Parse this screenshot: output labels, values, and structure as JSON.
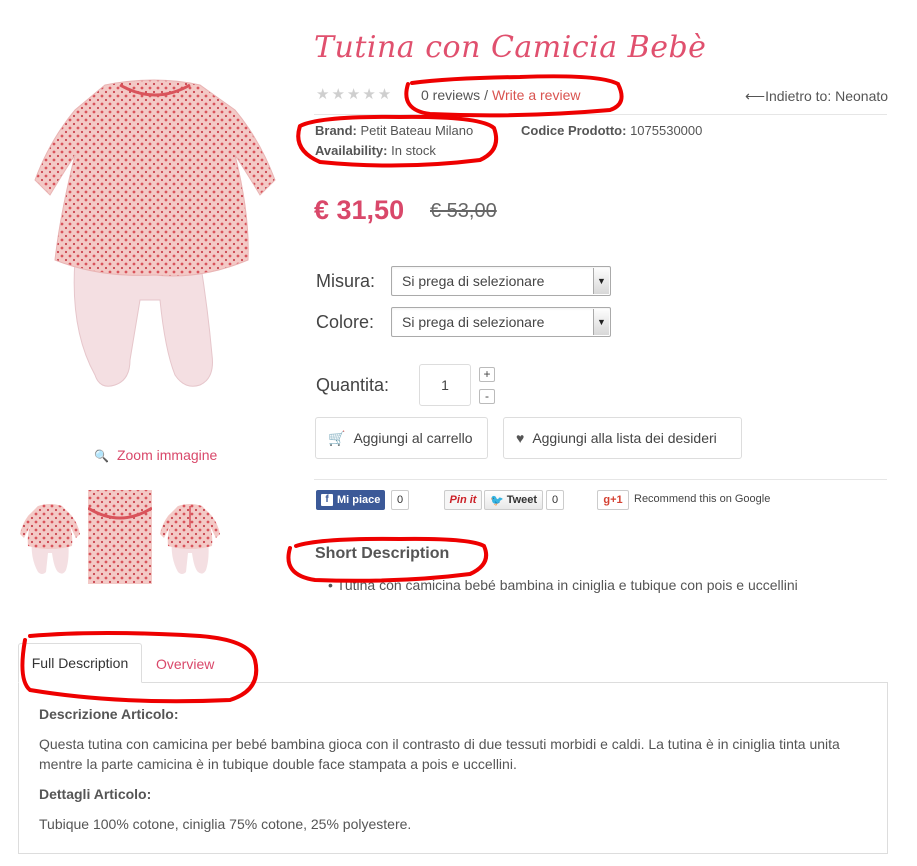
{
  "product": {
    "title": "Tutina con Camicia Bebè",
    "stars": "★★★★★",
    "reviews_count": "0 reviews",
    "reviews_sep": "/",
    "write_review": "Write a review",
    "back_link": "Indietro to: Neonato",
    "brand_label": "Brand:",
    "brand_value": "Petit Bateau Milano",
    "code_label": "Codice Prodotto:",
    "code_value": "1075530000",
    "availability_label": "Availability:",
    "availability_value": "In stock",
    "price": "€ 31,50",
    "old_price": "€ 53,00"
  },
  "options": {
    "size_label": "Misura:",
    "size_value": "Si prega di selezionare",
    "color_label": "Colore:",
    "color_value": "Si prega di selezionare",
    "qty_label": "Quantita:",
    "qty_value": "1",
    "plus": "+",
    "minus": "-"
  },
  "actions": {
    "add_to_cart": "Aggiungi al carrello",
    "add_to_wishlist": "Aggiungi alla lista dei desideri"
  },
  "social": {
    "fb_label": "Mi piace",
    "fb_count": "0",
    "pin_label": "Pin it",
    "tweet_label": "Tweet",
    "tweet_count": "0",
    "gplus_label": "g+1",
    "gplus_text": "Recommend this on Google"
  },
  "gallery": {
    "zoom_label": "Zoom immagine"
  },
  "short_description": {
    "title": "Short Description",
    "item": "Tutina con camicina bebé bambina in ciniglia e tubique con pois e uccellini"
  },
  "tabs": [
    {
      "label": "Full Description"
    },
    {
      "label": "Overview"
    }
  ],
  "full_description": {
    "heading1": "Descrizione Articolo:",
    "paragraph1_line1": "Questa tutina con camicina per bebé bambina gioca con il contrasto di due tessuti morbidi e caldi. La tutina è in ciniglia tinta unita",
    "paragraph1_line2": "mentre la parte camicina è in tubique double face stampata a pois e uccellini.",
    "heading2": "Dettagli Articolo:",
    "paragraph2": "Tubique 100% cotone, ciniglia 75% cotone, 25% polyestere."
  },
  "colors": {
    "accent": "#d9486a",
    "annotation": "#ee0000",
    "facebook": "#3b5998"
  }
}
